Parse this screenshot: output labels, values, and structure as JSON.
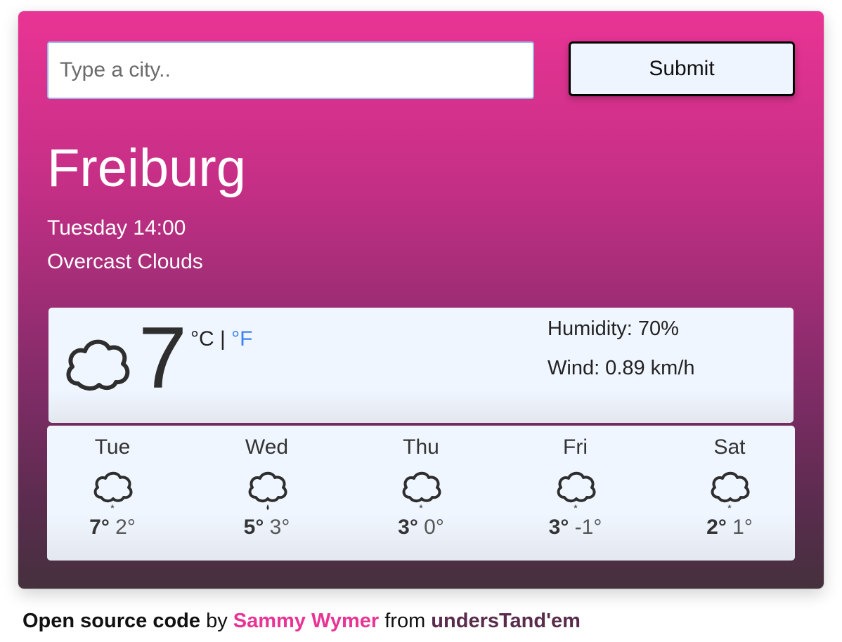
{
  "search": {
    "placeholder": "Type a city..",
    "submit_label": "Submit"
  },
  "current": {
    "city": "Freiburg",
    "date": "Tuesday 14:00",
    "description": "Overcast Clouds",
    "temperature": "7",
    "unit_c": "°C",
    "unit_sep": " | ",
    "unit_f": "°F",
    "humidity": "Humidity: 70%",
    "wind": "Wind: 0.89 km/h",
    "icon": "cloud-icon"
  },
  "forecast": [
    {
      "day": "Tue",
      "max": "7°",
      "min": "2°",
      "icon": "cloud-snow-icon"
    },
    {
      "day": "Wed",
      "max": "5°",
      "min": "3°",
      "icon": "cloud-rain-icon"
    },
    {
      "day": "Thu",
      "max": "3°",
      "min": "0°",
      "icon": "cloud-snow-icon"
    },
    {
      "day": "Fri",
      "max": "3°",
      "min": "-1°",
      "icon": "cloud-snow-icon"
    },
    {
      "day": "Sat",
      "max": "2°",
      "min": "1°",
      "icon": "cloud-snow-icon"
    }
  ],
  "footer": {
    "code_label": "Open source code",
    "by": " by ",
    "author": "Sammy Wymer",
    "from": " from ",
    "brand": "undersTand'em"
  },
  "colors": {
    "accent": "#e93494",
    "link": "#3b82f6",
    "panel": "#f0f6ff"
  }
}
